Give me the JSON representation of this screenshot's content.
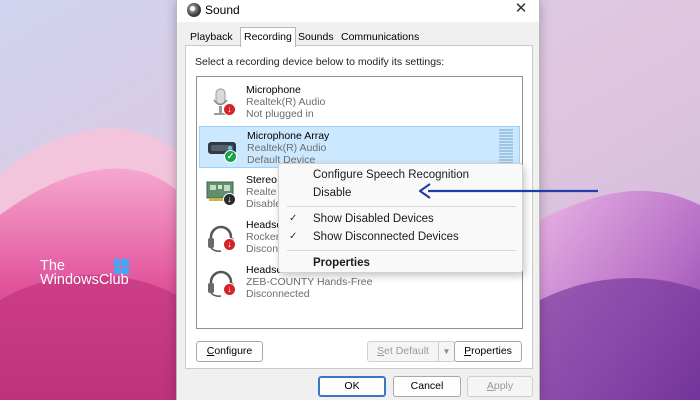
{
  "brand": {
    "line1": "The",
    "line2": "WindowsClub"
  },
  "window": {
    "title": "Sound",
    "app_icon": "speaker-icon",
    "close_icon": "close-icon",
    "close_glyph": "✕"
  },
  "tabs": [
    {
      "label": "Playback",
      "active": false
    },
    {
      "label": "Recording",
      "active": true
    },
    {
      "label": "Sounds",
      "active": false
    },
    {
      "label": "Communications",
      "active": false
    }
  ],
  "instruction": "Select a recording device below to modify its settings:",
  "devices": [
    {
      "name": "Microphone",
      "driver": "Realtek(R) Audio",
      "status": "Not plugged in",
      "icon": "microphone-icon",
      "badge": "red-down-arrow"
    },
    {
      "name": "Microphone Array",
      "driver": "Realtek(R) Audio",
      "status": "Default Device",
      "icon": "microphone-array-icon",
      "badge": "green-check",
      "selected": true
    },
    {
      "name": "Stereo",
      "driver": "Realte",
      "status": "Disable",
      "icon": "sound-card-icon",
      "badge": "black-down-arrow"
    },
    {
      "name": "Headse",
      "driver": "Rocker",
      "status": "Disconn",
      "icon": "headset-icon",
      "badge": "red-down-arrow"
    },
    {
      "name": "Headset",
      "driver": "ZEB-COUNTY Hands-Free",
      "status": "Disconnected",
      "icon": "headset-icon",
      "badge": "red-down-arrow"
    }
  ],
  "context_menu": {
    "items": [
      {
        "label": "Configure Speech Recognition",
        "checked": false
      },
      {
        "label": "Disable",
        "checked": false
      },
      {
        "label": "Show Disabled Devices",
        "checked": true
      },
      {
        "label": "Show Disconnected Devices",
        "checked": true
      },
      {
        "label": "Properties",
        "checked": false,
        "bold": true
      }
    ],
    "check_glyph": "✓"
  },
  "buttons": {
    "configure": {
      "label": "Configure",
      "access_key": "C",
      "rest": "onfigure"
    },
    "set_default": {
      "label": "Set Default",
      "access_key": "S",
      "rest": "et Default"
    },
    "set_default_arrow": "▼",
    "properties": {
      "label": "Properties",
      "access_key": "P",
      "rest": "roperties"
    },
    "ok": "OK",
    "cancel": "Cancel",
    "apply": {
      "label": "Apply",
      "access_key": "A",
      "rest": "pply"
    }
  },
  "colors": {
    "accent": "#1f3fa6",
    "selection": "#cce8ff"
  }
}
